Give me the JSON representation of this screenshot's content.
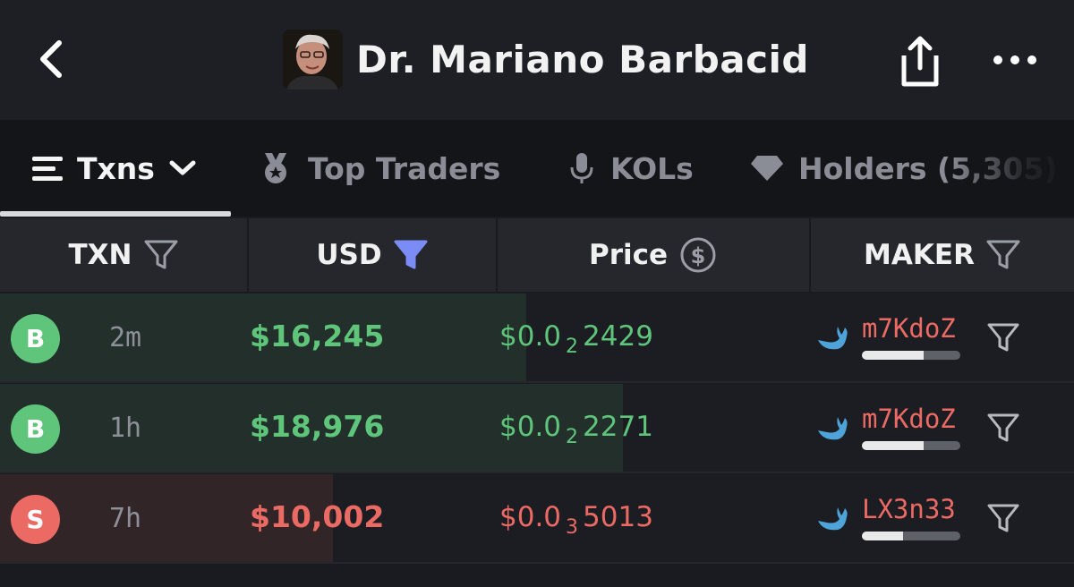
{
  "header": {
    "title": "Dr. Mariano Barbacid",
    "back_icon": "chevron-left-icon",
    "share_icon": "share-icon",
    "more_icon": "more-horizontal-icon"
  },
  "tabs": [
    {
      "label": "Txns",
      "icon": "list-icon",
      "active": true
    },
    {
      "label": "Top Traders",
      "icon": "medal-icon",
      "active": false
    },
    {
      "label": "KOLs",
      "icon": "microphone-icon",
      "active": false
    },
    {
      "label": "Holders (5,305)",
      "icon": "diamond-icon",
      "active": false
    }
  ],
  "columns": {
    "txn": "TXN",
    "usd": "USD",
    "price": "Price",
    "maker": "MAKER"
  },
  "colors": {
    "buy": "#5fc57a",
    "sell": "#ec6a64",
    "filter_active": "#7b8cf6",
    "whale": "#4ea3d8"
  },
  "rows": [
    {
      "type": "B",
      "side": "buy",
      "age": "2m",
      "usd": "$16,245",
      "price_prefix": "$0.0",
      "price_zeros": "2",
      "price_digits": "2429",
      "maker": "m7KdoZ",
      "bar_fraction": 0.49,
      "maker_level": 0.63
    },
    {
      "type": "B",
      "side": "buy",
      "age": "1h",
      "usd": "$18,976",
      "price_prefix": "$0.0",
      "price_zeros": "2",
      "price_digits": "2271",
      "maker": "m7KdoZ",
      "bar_fraction": 0.58,
      "maker_level": 0.63
    },
    {
      "type": "S",
      "side": "sell",
      "age": "7h",
      "usd": "$10,002",
      "price_prefix": "$0.0",
      "price_zeros": "3",
      "price_digits": "5013",
      "maker": "LX3n33",
      "bar_fraction": 0.31,
      "maker_level": 0.42
    }
  ]
}
